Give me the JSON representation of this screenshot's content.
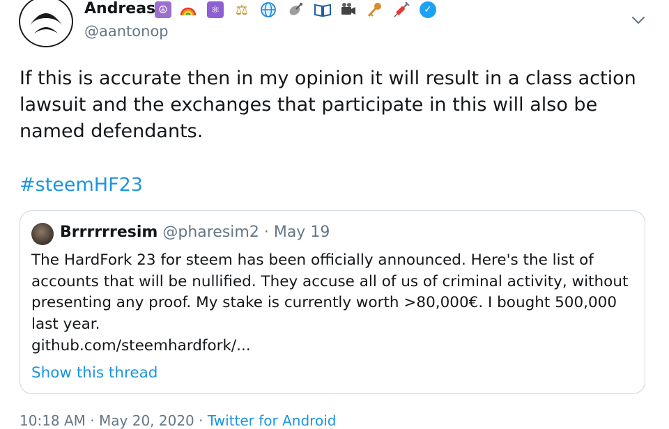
{
  "author": {
    "name": "Andreas",
    "handle": "@aantonop",
    "verified": true,
    "emojis": [
      "peace-icon",
      "rainbow-icon",
      "atom-icon",
      "scales-icon",
      "globe-icon",
      "satellite-icon",
      "book-icon",
      "camera-icon",
      "key-icon",
      "syringe-icon",
      "verified-badge-icon"
    ]
  },
  "tweet": {
    "text": "If this is accurate then in my opinion it will result in a class action lawsuit and the exchanges that participate in this will also be named defendants.",
    "hashtag": "#steemHF23"
  },
  "quote": {
    "name": "Brrrrrresim",
    "handle": "@pharesim2",
    "separator": " · ",
    "date": "May 19",
    "text": "The HardFork 23 for steem has been officially announced. Here's the list of accounts that will be nullified. They accuse all of us of criminal activity, without presenting any proof. My stake is currently worth >80,000€. I bought 500,000 last year.",
    "link": "github.com/steemhardfork/...",
    "show_thread": "Show this thread"
  },
  "footer": {
    "time": "10:18 AM",
    "separator": " · ",
    "date": "May 20, 2020",
    "app": "Twitter for Android"
  },
  "colors": {
    "link": "#1b95e0",
    "secondary": "#657786",
    "border": "#ccd6dd",
    "verified": "#1da1f2"
  }
}
